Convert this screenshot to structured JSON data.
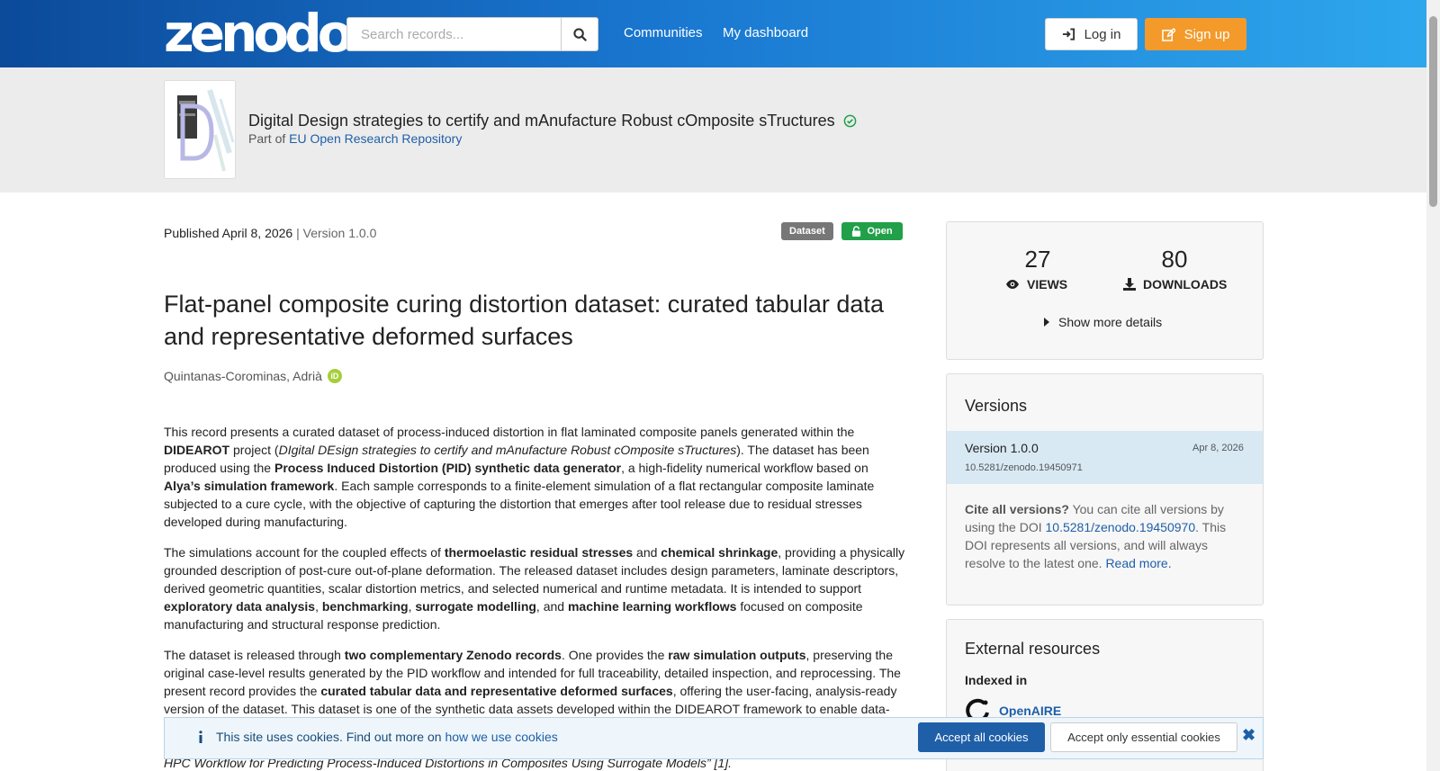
{
  "header": {
    "logo": "zenodo",
    "search_placeholder": "Search records...",
    "nav": [
      "Communities",
      "My dashboard"
    ],
    "login": "Log in",
    "signup": "Sign up"
  },
  "community": {
    "title": "Digital Design strategies to certify and mAnufacture Robust cOmposite sTructures",
    "part_of_prefix": "Part of",
    "part_of_link": "EU Open Research Repository"
  },
  "record": {
    "published": "Published April 8, 2026",
    "version": "| Version 1.0.0",
    "badge_type": "Dataset",
    "badge_access": "Open",
    "title": "Flat-panel composite curing distortion dataset: curated tabular data and representative deformed surfaces",
    "creator": "Quintanas-Corominas, Adrià",
    "desc": {
      "p1_a": "This record presents a curated dataset of process-induced distortion in flat laminated composite panels generated within the ",
      "p1_b": "DIDEAROT",
      "p1_c": " project (",
      "p1_d": "DIgital DEsign strategies to certify and mAnufacture Robust cOmposite sTructures",
      "p1_e": "). The dataset has been produced using the ",
      "p1_f": "Process Induced Distortion (PID) synthetic data generator",
      "p1_g": ", a high-fidelity numerical workflow based on ",
      "p1_h": "Alya’s simulation framework",
      "p1_i": ". Each sample corresponds to a finite-element simulation of a flat rectangular composite laminate subjected to a cure cycle, with the objective of capturing the distortion that emerges after tool release due to residual stresses developed during manufacturing.",
      "p2_a": "The simulations account for the coupled effects of ",
      "p2_b": "thermoelastic residual stresses",
      "p2_c": " and ",
      "p2_d": "chemical shrinkage",
      "p2_e": ", providing a physically grounded description of post-cure out-of-plane deformation. The released dataset includes design parameters, laminate descriptors, derived geometric quantities, scalar distortion metrics, and selected numerical and runtime metadata. It is intended to support ",
      "p2_f": "exploratory data analysis",
      "p2_g": ", ",
      "p2_h": "benchmarking",
      "p2_i": ", ",
      "p2_j": "surrogate modelling",
      "p2_k": ", and ",
      "p2_l": "machine learning workflows",
      "p2_m": " focused on composite manufacturing and structural response prediction.",
      "p3_a": "The dataset is released through ",
      "p3_b": "two complementary Zenodo records",
      "p3_c": ". One provides the ",
      "p3_d": "raw simulation outputs",
      "p3_e": ", preserving the original case-level results generated by the PID workflow and intended for full traceability, detailed inspection, and reprocessing. The present record provides the ",
      "p3_f": "curated tabular data and representative deformed surfaces",
      "p3_g": ", offering the user-facing, analysis-ready version of the dataset. This dataset is one of the synthetic data assets developed within the DIDEAROT framework to enable data-",
      "p3_tail": "HPC Workflow for Predicting Process-Induced Distortions in Composites Using Surrogate Models” [1]."
    }
  },
  "stats": {
    "views": "27",
    "views_label": "VIEWS",
    "downloads": "80",
    "downloads_label": "DOWNLOADS",
    "show_more": "Show more details"
  },
  "versions": {
    "heading": "Versions",
    "item_name": "Version 1.0.0",
    "item_date": "Apr 8, 2026",
    "item_doi": "10.5281/zenodo.19450971",
    "cite_bold": "Cite all versions?",
    "cite_a": " You can cite all versions by using the DOI ",
    "cite_doi": "10.5281/zenodo.19450970",
    "cite_b": ". This DOI represents all versions, and will always resolve to the latest one. ",
    "cite_more": "Read more."
  },
  "external": {
    "heading": "External resources",
    "indexed": "Indexed in",
    "openaire": "OpenAIRE"
  },
  "cookie": {
    "text": "This site uses cookies. Find out more on ",
    "link": "how we use cookies",
    "accept_all": "Accept all cookies",
    "accept_essential": "Accept only essential cookies"
  },
  "colors": {
    "header_start": "#0c4a9a",
    "header_end": "#2ea8ee",
    "signup": "#f39a2b",
    "open_badge": "#21a049",
    "link": "#1f5fa8"
  },
  "icons": [
    "search-icon",
    "login-icon",
    "signup-icon",
    "verified-icon",
    "lock-open-icon",
    "orcid-icon",
    "eye-icon",
    "download-icon",
    "caret-right-icon",
    "info-icon",
    "close-icon",
    "openaire-icon"
  ]
}
